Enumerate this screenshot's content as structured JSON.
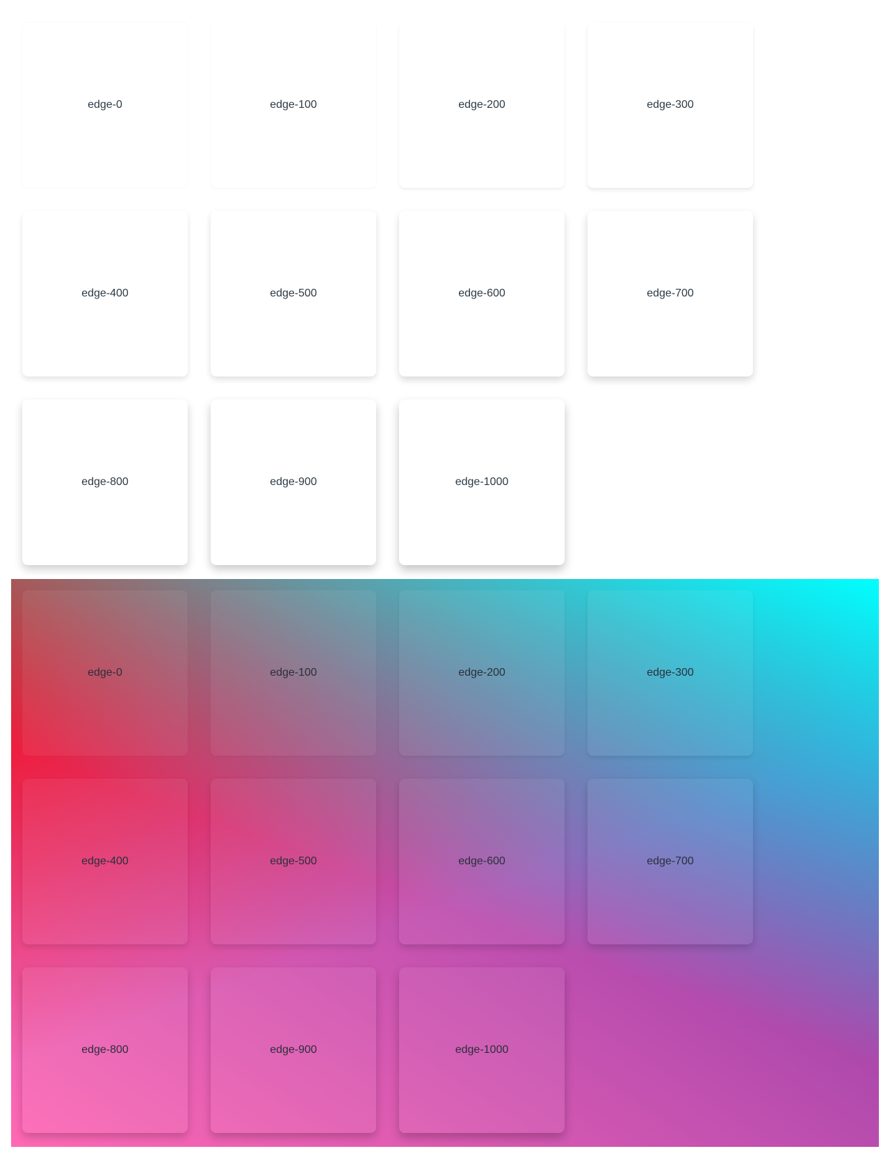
{
  "light_section": {
    "cards": [
      {
        "label": "edge-0"
      },
      {
        "label": "edge-100"
      },
      {
        "label": "edge-200"
      },
      {
        "label": "edge-300"
      },
      {
        "label": "edge-400"
      },
      {
        "label": "edge-500"
      },
      {
        "label": "edge-600"
      },
      {
        "label": "edge-700"
      },
      {
        "label": "edge-800"
      },
      {
        "label": "edge-900"
      },
      {
        "label": "edge-1000"
      }
    ]
  },
  "gradient_section": {
    "colors": {
      "top_left": "#ff0000",
      "top_right": "#00ffff",
      "bottom_left": "#ff69b4",
      "bottom_right": "#663399"
    },
    "cards": [
      {
        "label": "edge-0"
      },
      {
        "label": "edge-100"
      },
      {
        "label": "edge-200"
      },
      {
        "label": "edge-300"
      },
      {
        "label": "edge-400"
      },
      {
        "label": "edge-500"
      },
      {
        "label": "edge-600"
      },
      {
        "label": "edge-700"
      },
      {
        "label": "edge-800"
      },
      {
        "label": "edge-900"
      },
      {
        "label": "edge-1000"
      }
    ]
  }
}
